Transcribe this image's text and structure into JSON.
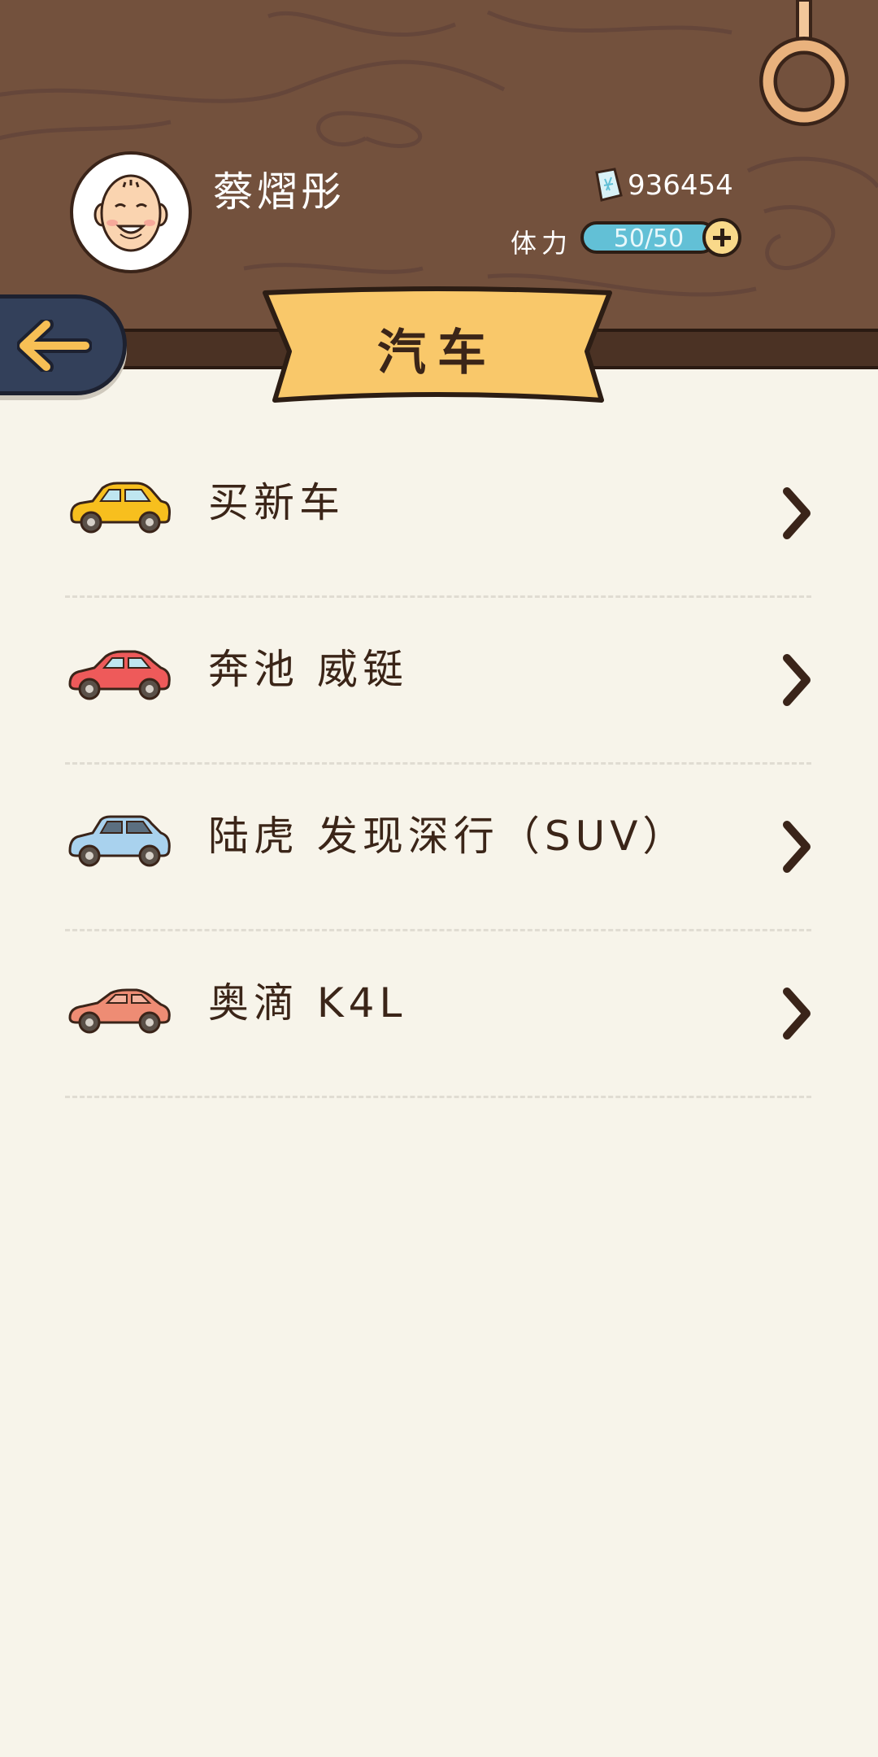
{
  "player": {
    "name": "蔡熠彤",
    "currency_value": "936454",
    "currency_icon": "money-bill-icon",
    "stamina_label": "体力",
    "stamina_value": "50/50",
    "stamina_fill": 1.0
  },
  "header": {
    "title": "汽车",
    "back_icon": "back-arrow-icon"
  },
  "list": {
    "items": [
      {
        "label": "买新车",
        "icon": "yellow-car-icon",
        "color": "#f7bf1e"
      },
      {
        "label": "奔池 威铤",
        "icon": "red-car-icon",
        "color": "#ee5a5a"
      },
      {
        "label": "陆虎 发现深行（SUV）",
        "icon": "blue-suv-icon",
        "color": "#a9d2ee"
      },
      {
        "label": "奥滴 K4L",
        "icon": "salmon-car-icon",
        "color": "#ee8c74"
      }
    ]
  },
  "colors": {
    "wood": "#73513d",
    "background": "#f7f4ea",
    "banner": "#f9c86a",
    "back_button": "#33405a",
    "stamina_bar": "#62c0d6"
  }
}
